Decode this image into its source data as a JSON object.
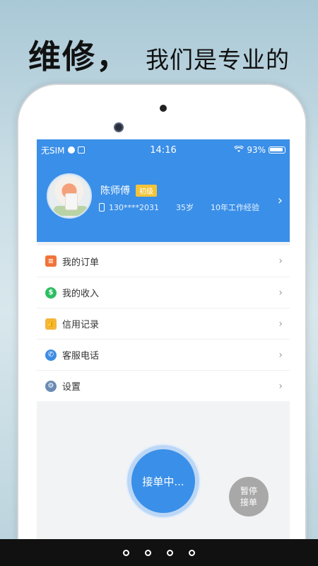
{
  "hero": {
    "title_big": "维修，",
    "title_small": "我们是专业的"
  },
  "status": {
    "carrier": "无SIM",
    "time": "14:16",
    "battery": "93%"
  },
  "profile": {
    "name": "陈师傅",
    "level": "初级",
    "phone": "130****2031",
    "age": "35岁",
    "experience": "10年工作经验"
  },
  "menu": [
    {
      "label": "我的订单",
      "icon": "orders-icon",
      "color": "#f0743a"
    },
    {
      "label": "我的收入",
      "icon": "income-icon",
      "color": "#2dbf62"
    },
    {
      "label": "信用记录",
      "icon": "credit-icon",
      "color": "#f4b63b"
    },
    {
      "label": "客服电话",
      "icon": "phone-icon",
      "color": "#3c8ce4"
    },
    {
      "label": "设置",
      "icon": "gear-icon",
      "color": "#6a8bb5"
    }
  ],
  "actions": {
    "accept": "接单中...",
    "pause_line1": "暂停",
    "pause_line2": "接单"
  },
  "colors": {
    "accent": "#3a8fe8"
  }
}
